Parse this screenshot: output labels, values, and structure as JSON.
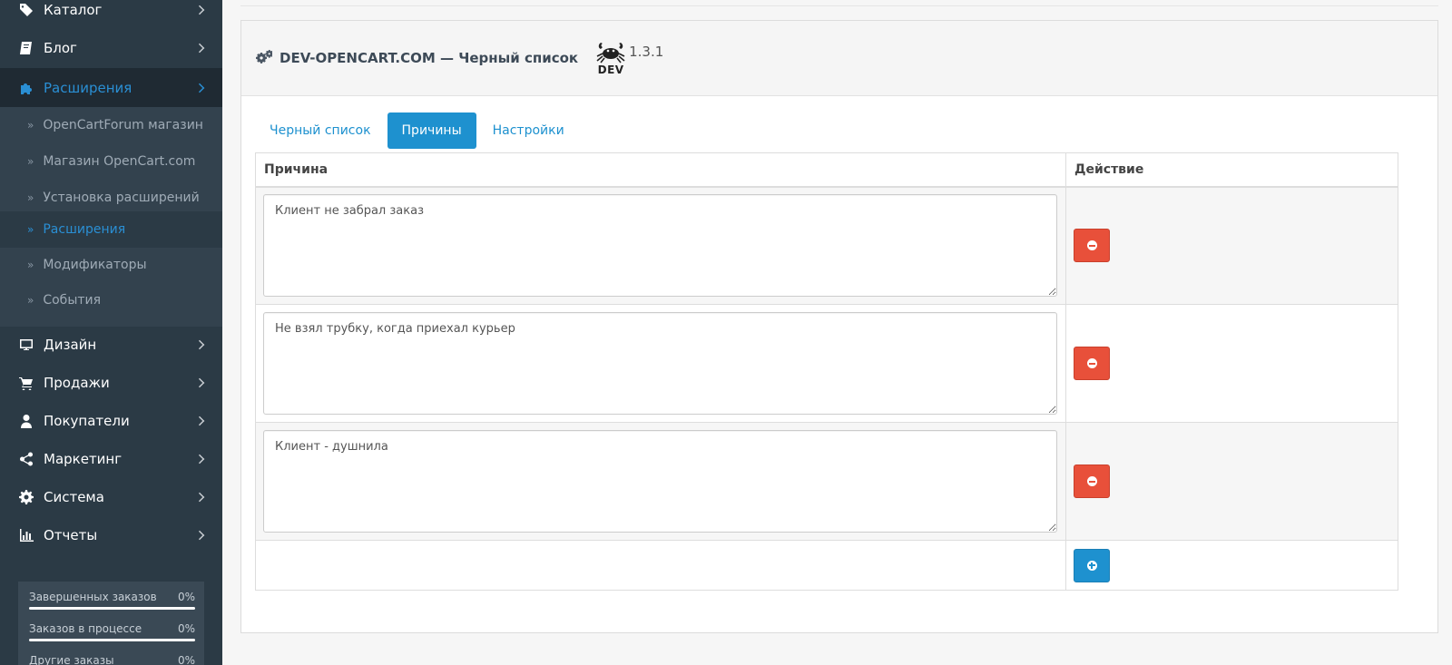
{
  "sidebar": {
    "items": [
      {
        "label": "Каталог",
        "icon": "tag-icon"
      },
      {
        "label": "Блог",
        "icon": "book-icon"
      },
      {
        "label": "Расширения",
        "icon": "puzzle-icon",
        "active": true
      },
      {
        "label": "Дизайн",
        "icon": "monitor-icon"
      },
      {
        "label": "Продажи",
        "icon": "cart-icon"
      },
      {
        "label": "Покупатели",
        "icon": "user-icon"
      },
      {
        "label": "Маркетинг",
        "icon": "share-icon"
      },
      {
        "label": "Система",
        "icon": "gear-icon"
      },
      {
        "label": "Отчеты",
        "icon": "bar-chart-icon"
      }
    ],
    "submenu": [
      {
        "label": "OpenCartForum магазин"
      },
      {
        "label": "Магазин OpenCart.com"
      },
      {
        "label": "Установка расширений"
      },
      {
        "label": "Расширения",
        "active": true
      },
      {
        "label": "Модификаторы"
      },
      {
        "label": "События"
      }
    ],
    "stats": [
      {
        "label": "Завершенных заказов",
        "value": "0%",
        "progress": 0
      },
      {
        "label": "Заказов в процессе",
        "value": "0%",
        "progress": 0
      },
      {
        "label": "Другие заказы",
        "value": "0%",
        "progress": 0
      }
    ]
  },
  "panel": {
    "title": "DEV-OPENCART.COM — Черный список",
    "logo_text": "DEV",
    "version": "1.3.1"
  },
  "tabs": [
    {
      "label": "Черный список"
    },
    {
      "label": "Причины",
      "active": true
    },
    {
      "label": "Настройки"
    }
  ],
  "table": {
    "col_reason": "Причина",
    "col_action": "Действие",
    "rows": [
      {
        "reason": "Клиент не забрал заказ"
      },
      {
        "reason": "Не взял трубку, когда приехал курьер"
      },
      {
        "reason": "Клиент - душнила"
      }
    ]
  },
  "colors": {
    "sidebar_bg": "#2b3a45",
    "accent": "#1e91cf",
    "danger": "#e8503a"
  }
}
